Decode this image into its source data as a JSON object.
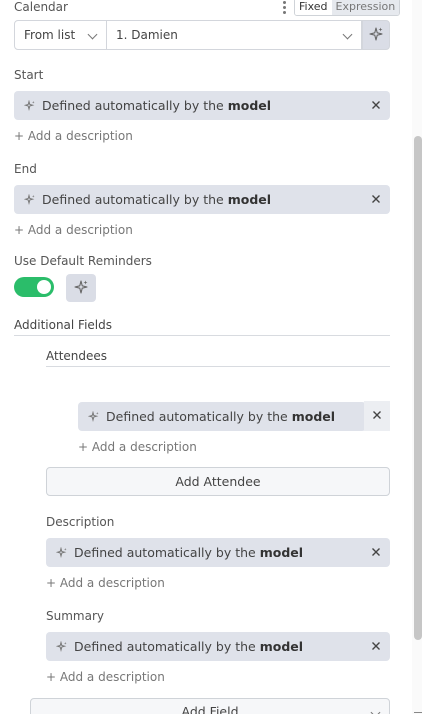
{
  "calendar": {
    "label": "Calendar",
    "mode_toggle": {
      "fixed": "Fixed",
      "expression": "Expression"
    },
    "mode_select": "From list",
    "value_select": "1. Damien"
  },
  "ai_value": {
    "prefix": "Defined automatically by the",
    "bold": "model"
  },
  "add_description": "+ Add a description",
  "fields": {
    "start": "Start",
    "end": "End",
    "use_default_reminders": "Use Default Reminders"
  },
  "reminders_toggle": {
    "on": true,
    "color": "#2bbd6a"
  },
  "additional_fields": {
    "title": "Additional Fields",
    "attendees": {
      "title": "Attendees",
      "add_button": "Add Attendee"
    },
    "description": "Description",
    "summary": "Summary",
    "add_field_button": "Add Field"
  },
  "icons": [
    "sparkle-icon",
    "close-icon",
    "chevron-down-icon",
    "more-vertical-icon"
  ]
}
